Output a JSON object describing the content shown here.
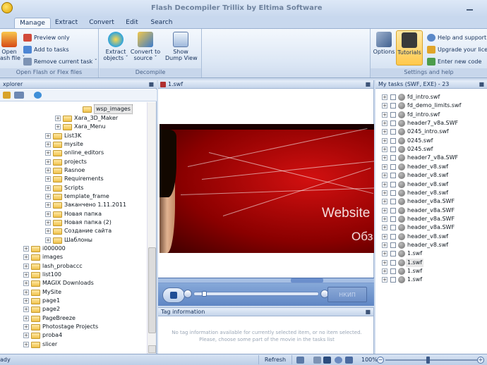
{
  "window": {
    "title": "Flash Decompiler Trillix by Eltima Software"
  },
  "tabs": [
    "Manage",
    "Extract",
    "Convert",
    "Edit",
    "Search"
  ],
  "ribbon": {
    "open_group": {
      "title": "Open Flash or Flex files",
      "open_label": "Open",
      "open_label2": "ash file ˇ",
      "preview_only": "Preview only",
      "add_to_tasks": "Add to tasks",
      "remove_current_task": "Remove current task ˇ"
    },
    "decompile_group": {
      "title": "Decompile",
      "extract_label": "Extract",
      "extract_label2": "objects ˇ",
      "convert_label": "Convert to",
      "convert_label2": "source ˇ",
      "show_dump_label": "Show",
      "show_dump_label2": "Dump View"
    },
    "settings_group": {
      "title": "Settings and help",
      "options_label": "Options",
      "tutorials_label": "Tutorials",
      "help_support": "Help and support ˇ",
      "upgrade_license": "Upgrade your licens",
      "enter_new_code": "Enter new code"
    }
  },
  "explorer": {
    "title": "xplorer",
    "pin": "■",
    "tree": [
      {
        "label": "wsp_images",
        "expander": "",
        "selected": true
      },
      {
        "label": "Xara_3D_Maker",
        "expander": "+"
      },
      {
        "label": "Xara_Menu",
        "expander": "+"
      },
      {
        "label": "List3K",
        "expander": "+"
      },
      {
        "label": "mysite",
        "expander": "+"
      },
      {
        "label": "online_editors",
        "expander": "+"
      },
      {
        "label": "projects",
        "expander": "+"
      },
      {
        "label": "Rasnoe",
        "expander": "+"
      },
      {
        "label": "Requirements",
        "expander": "+"
      },
      {
        "label": "Scripts",
        "expander": "+"
      },
      {
        "label": "template_frame",
        "expander": "+"
      },
      {
        "label": "Заканчено 1.11.2011",
        "expander": "+"
      },
      {
        "label": "Новая папка",
        "expander": "+"
      },
      {
        "label": "Новая папка (2)",
        "expander": "+"
      },
      {
        "label": "Создание сайта",
        "expander": "+"
      },
      {
        "label": "Шаблоны",
        "expander": "+"
      },
      {
        "label": "i000000",
        "expander": "+"
      },
      {
        "label": "images",
        "expander": "+"
      },
      {
        "label": "lash_probaccc",
        "expander": "+"
      },
      {
        "label": "list100",
        "expander": "+"
      },
      {
        "label": "MAGIX Downloads",
        "expander": "+"
      },
      {
        "label": "MySite",
        "expander": "+"
      },
      {
        "label": "page1",
        "expander": "+"
      },
      {
        "label": "page2",
        "expander": "+"
      },
      {
        "label": "PageBreeze",
        "expander": "+"
      },
      {
        "label": "Photostage Projects",
        "expander": "+"
      },
      {
        "label": "proba4",
        "expander": "+"
      },
      {
        "label": "slicer",
        "expander": "+"
      }
    ]
  },
  "player": {
    "title": "1.swf",
    "pin": "■",
    "movie_title1": "Website F",
    "movie_title2": "Обз",
    "go_label": "НКИП"
  },
  "tag_info": {
    "title": "Tag information",
    "pin": "■",
    "message": "No tag information available for currently selected item, or no item selected. Please, choose some part of the movie in the tasks list"
  },
  "tasks": {
    "title": "My tasks (SWF, EXE) - 23",
    "pin": "■",
    "items": [
      {
        "label": "fd_intro.swf"
      },
      {
        "label": "fd_demo_limits.swf"
      },
      {
        "label": "fd_intro.swf"
      },
      {
        "label": "header7_v8a.SWF"
      },
      {
        "label": "0245_intro.swf"
      },
      {
        "label": "0245.swf"
      },
      {
        "label": "0245.swf"
      },
      {
        "label": "header7_v8a.SWF"
      },
      {
        "label": "header_v8.swf"
      },
      {
        "label": "header_v8.swf"
      },
      {
        "label": "header_v8.swf"
      },
      {
        "label": "header_v8.swf"
      },
      {
        "label": "header_v8a.SWF"
      },
      {
        "label": "header_v8a.SWF"
      },
      {
        "label": "header_v8a.SWF"
      },
      {
        "label": "header_v8a.SWF"
      },
      {
        "label": "header_v8.swf"
      },
      {
        "label": "header_v8.swf"
      },
      {
        "label": "1.swf"
      },
      {
        "label": "1.swf",
        "selected": true
      },
      {
        "label": "1.swf"
      },
      {
        "label": "1.swf"
      }
    ]
  },
  "statusbar": {
    "ready": "ady",
    "refresh": "Refresh",
    "zoom": "100%",
    "zoom_minus": "−",
    "zoom_plus": "+"
  },
  "colors": {
    "accent": "#c8d8ee",
    "movie_red": "#c00000",
    "folder": "#f0c24c"
  }
}
